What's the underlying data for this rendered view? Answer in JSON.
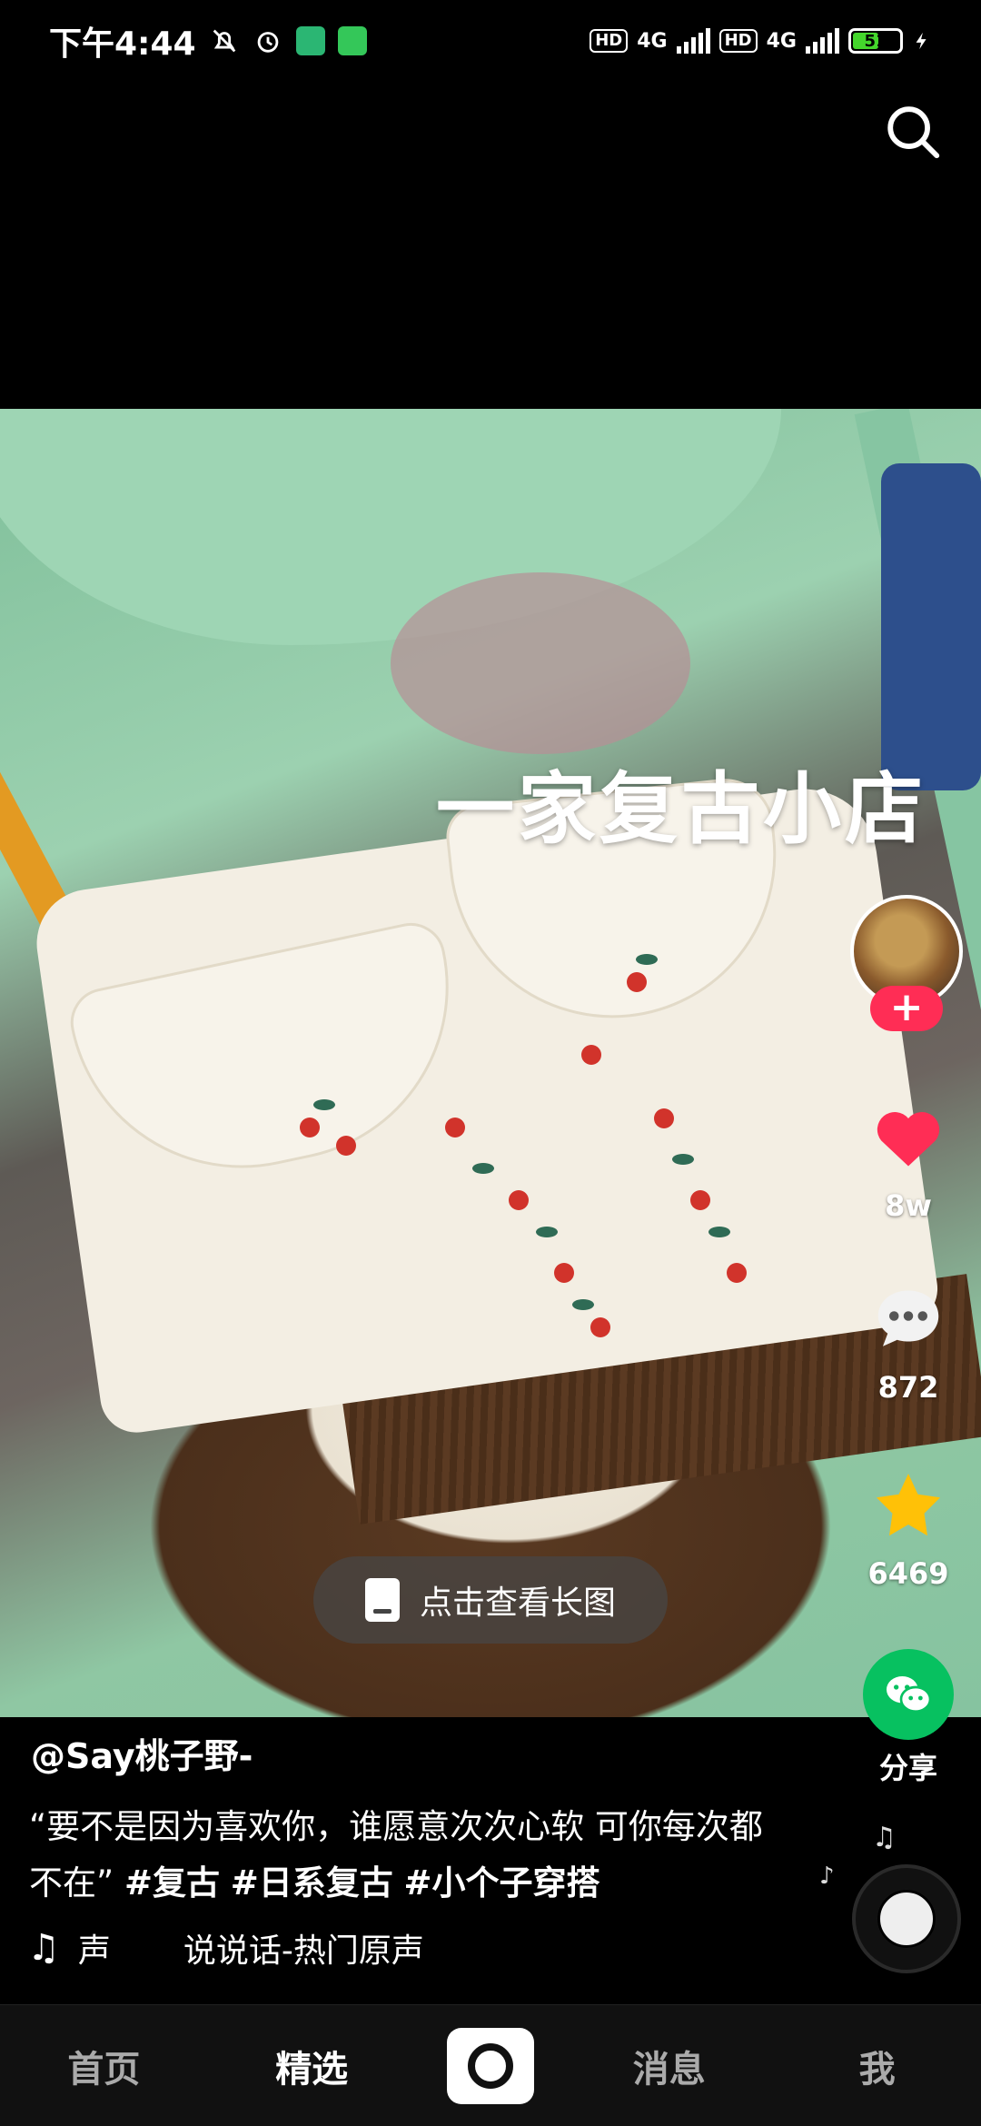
{
  "status_bar": {
    "time": "下午4:44",
    "network_1": "4G",
    "network_2": "4G",
    "hd_1": "HD",
    "hd_2": "HD",
    "battery": "51"
  },
  "media": {
    "overlay_title": "一家复古小店",
    "view_long_image_label": "点击查看长图"
  },
  "actions": {
    "likes": "8w",
    "comments": "872",
    "favorites": "6469",
    "share_label": "分享",
    "follow_label": "+"
  },
  "post": {
    "author": "@Say桃子野-",
    "description_text": "“要不是因为喜欢你，谁愿意次次心软 可你每次都不在”",
    "hashtags": [
      "#复古",
      "#日系复古",
      "#小个子穿搭"
    ],
    "music_left": "声",
    "music_title": "说说话-热门原声"
  },
  "bottom_nav": {
    "home": "首页",
    "featured": "精选",
    "messages": "消息",
    "me": "我"
  },
  "colors": {
    "like_red": "#ff2d55",
    "share_green": "#07c160",
    "star_yellow": "#ffc107"
  }
}
